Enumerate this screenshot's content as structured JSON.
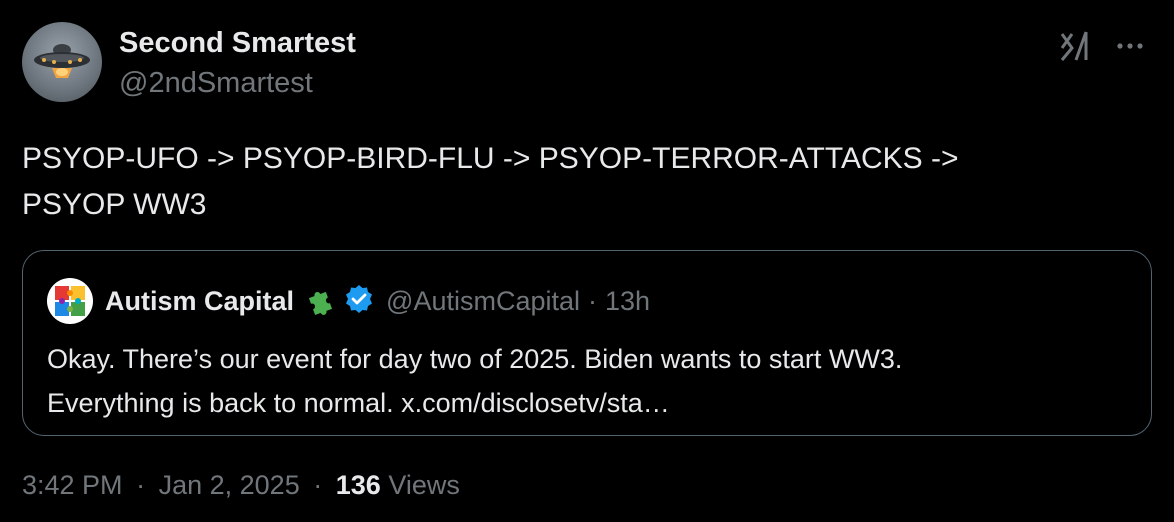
{
  "author": {
    "display_name": "Second Smartest",
    "handle": "@2ndSmartest",
    "avatar_icon": "ufo-icon"
  },
  "header_icons": {
    "x_logo": "x-logo-icon",
    "more": "more-icon"
  },
  "tweet": {
    "lines": [
      "PSYOP-UFO -> PSYOP-BIRD-FLU -> PSYOP-TERROR-ATTACKS ->",
      "PSYOP WW3"
    ]
  },
  "quoted_tweet": {
    "display_name": "Autism Capital",
    "handle": "@AutismCapital",
    "separator": "·",
    "time": "13h",
    "avatar_icon": "rainbow-puzzle-icon",
    "badges": [
      "puzzle-icon",
      "verified-icon"
    ],
    "lines": [
      "Okay. There’s our event for day two of 2025. Biden wants to start WW3.",
      "Everything is back to normal. x.com/disclosetv/sta…"
    ]
  },
  "meta": {
    "time": "3:42 PM",
    "separator": "·",
    "date": "Jan 2, 2025",
    "views_count": "136",
    "views_label": "Views"
  },
  "colors": {
    "background": "#000000",
    "text_primary": "#e7e9ea",
    "text_secondary": "#71767b",
    "border": "#536471",
    "verified": "#1d9bf0",
    "puzzle_green": "#4caf50"
  }
}
